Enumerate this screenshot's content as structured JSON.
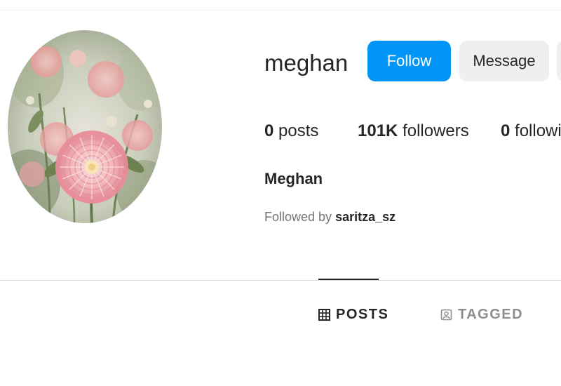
{
  "profile": {
    "username": "meghan",
    "full_name": "Meghan",
    "avatar": "dahlia-flower-photo"
  },
  "actions": {
    "follow_label": "Follow",
    "message_label": "Message",
    "more_icon": "options-icon"
  },
  "stats": {
    "posts_count": "0",
    "posts_label": "posts",
    "followers_count": "101K",
    "followers_label": "followers",
    "following_count": "0",
    "following_label": "following"
  },
  "followed_by": {
    "prefix": "Followed by",
    "user": "saritza_sz"
  },
  "tabs": [
    {
      "label": "POSTS",
      "icon": "grid-icon",
      "active": true
    },
    {
      "label": "TAGGED",
      "icon": "tag-user-icon",
      "active": false
    }
  ],
  "colors": {
    "accent": "#0095f6",
    "secondary_button": "#efefef",
    "text": "#262626",
    "muted_text": "#737373",
    "divider": "#dbdbdb"
  }
}
